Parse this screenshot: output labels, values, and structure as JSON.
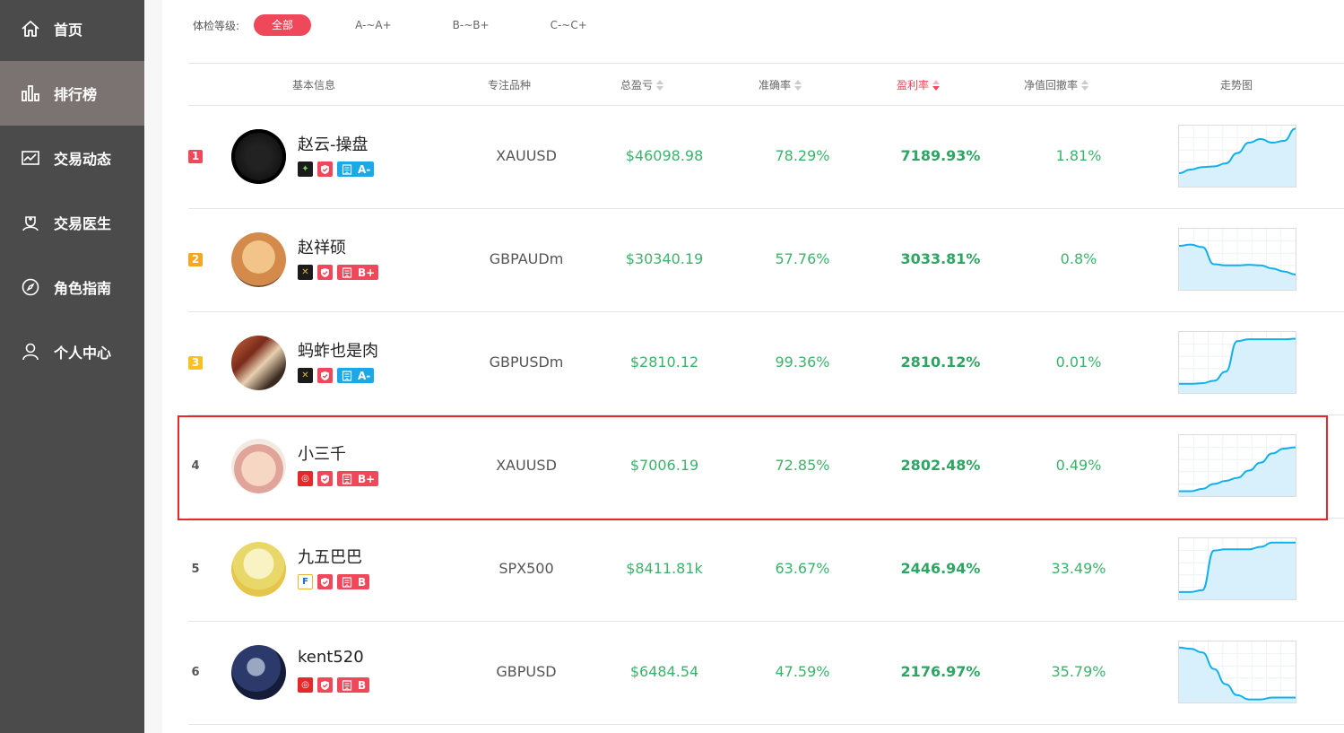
{
  "sidebar": {
    "items": [
      {
        "label": "首页",
        "icon": "home-icon"
      },
      {
        "label": "排行榜",
        "icon": "bar-chart-icon",
        "active": true
      },
      {
        "label": "交易动态",
        "icon": "line-chart-icon"
      },
      {
        "label": "交易医生",
        "icon": "doctor-icon"
      },
      {
        "label": "角色指南",
        "icon": "compass-icon"
      },
      {
        "label": "个人中心",
        "icon": "user-icon"
      }
    ]
  },
  "filter": {
    "label": "体检等级:",
    "options": [
      "全部",
      "A-~A+",
      "B-~B+",
      "C-~C+"
    ],
    "selected": "全部"
  },
  "table": {
    "headers": {
      "basic": "基本信息",
      "symbol": "专注品种",
      "profit": "总盈亏",
      "accuracy": "准确率",
      "yield": "盈利率",
      "drawdown": "净值回撤率",
      "trend": "走势图"
    },
    "sorted_column": "yield",
    "sort_direction": "desc",
    "rows": [
      {
        "rank": "1",
        "name": "赵云-操盘",
        "broker_icon": "broker-green-icon",
        "grade": "A-",
        "grade_color": "blue",
        "symbol": "XAUUSD",
        "profit": "$46098.98",
        "accuracy": "78.29%",
        "yield": "7189.93%",
        "drawdown": "1.81%",
        "trend": [
          0.22,
          0.28,
          0.32,
          0.33,
          0.38,
          0.55,
          0.72,
          0.78,
          0.72,
          0.75,
          0.95
        ]
      },
      {
        "rank": "2",
        "name": "赵祥硕",
        "broker_icon": "broker-gold-icon",
        "grade": "B+",
        "grade_color": "red",
        "symbol": "GBPAUDm",
        "profit": "$30340.19",
        "accuracy": "57.76%",
        "yield": "3033.81%",
        "drawdown": "0.8%",
        "trend": [
          0.72,
          0.74,
          0.7,
          0.42,
          0.4,
          0.4,
          0.41,
          0.4,
          0.35,
          0.3,
          0.25
        ]
      },
      {
        "rank": "3",
        "name": "蚂蚱也是肉",
        "broker_icon": "broker-gold-icon",
        "grade": "A-",
        "grade_color": "blue",
        "symbol": "GBPUSDm",
        "profit": "$2810.12",
        "accuracy": "99.36%",
        "yield": "2810.12%",
        "drawdown": "0.01%",
        "trend": [
          0.15,
          0.15,
          0.16,
          0.2,
          0.35,
          0.85,
          0.88,
          0.88,
          0.88,
          0.88,
          0.89
        ]
      },
      {
        "rank": "4",
        "name": "小三千",
        "broker_icon": "broker-red-icon",
        "grade": "B+",
        "grade_color": "red",
        "symbol": "XAUUSD",
        "profit": "$7006.19",
        "accuracy": "72.85%",
        "yield": "2802.48%",
        "drawdown": "0.49%",
        "trend": [
          0.08,
          0.08,
          0.12,
          0.2,
          0.25,
          0.3,
          0.42,
          0.55,
          0.7,
          0.78,
          0.8
        ],
        "highlighted": true
      },
      {
        "rank": "5",
        "name": "九五巴巴",
        "broker_icon": "broker-f-icon",
        "grade": "B",
        "grade_color": "red",
        "symbol": "SPX500",
        "profit": "$8411.81k",
        "accuracy": "63.67%",
        "yield": "2446.94%",
        "drawdown": "33.49%",
        "trend": [
          0.12,
          0.12,
          0.15,
          0.8,
          0.82,
          0.82,
          0.82,
          0.86,
          0.93,
          0.93,
          0.93
        ]
      },
      {
        "rank": "6",
        "name": "kent520",
        "broker_icon": "broker-red-icon",
        "grade": "B",
        "grade_color": "red",
        "symbol": "GBPUSD",
        "profit": "$6484.54",
        "accuracy": "47.59%",
        "yield": "2176.97%",
        "drawdown": "35.79%",
        "trend": [
          0.9,
          0.88,
          0.82,
          0.55,
          0.3,
          0.12,
          0.05,
          0.05,
          0.08,
          0.08,
          0.08
        ]
      }
    ]
  },
  "colors": {
    "accent": "#f0485b",
    "positive": "#3bb36b",
    "sidebar_bg": "#4b4b4b",
    "sidebar_active": "#7b7371",
    "sparkline": "#12b0ea",
    "sparkline_fill": "#d7f0fb",
    "highlight_border": "#e8272b"
  }
}
